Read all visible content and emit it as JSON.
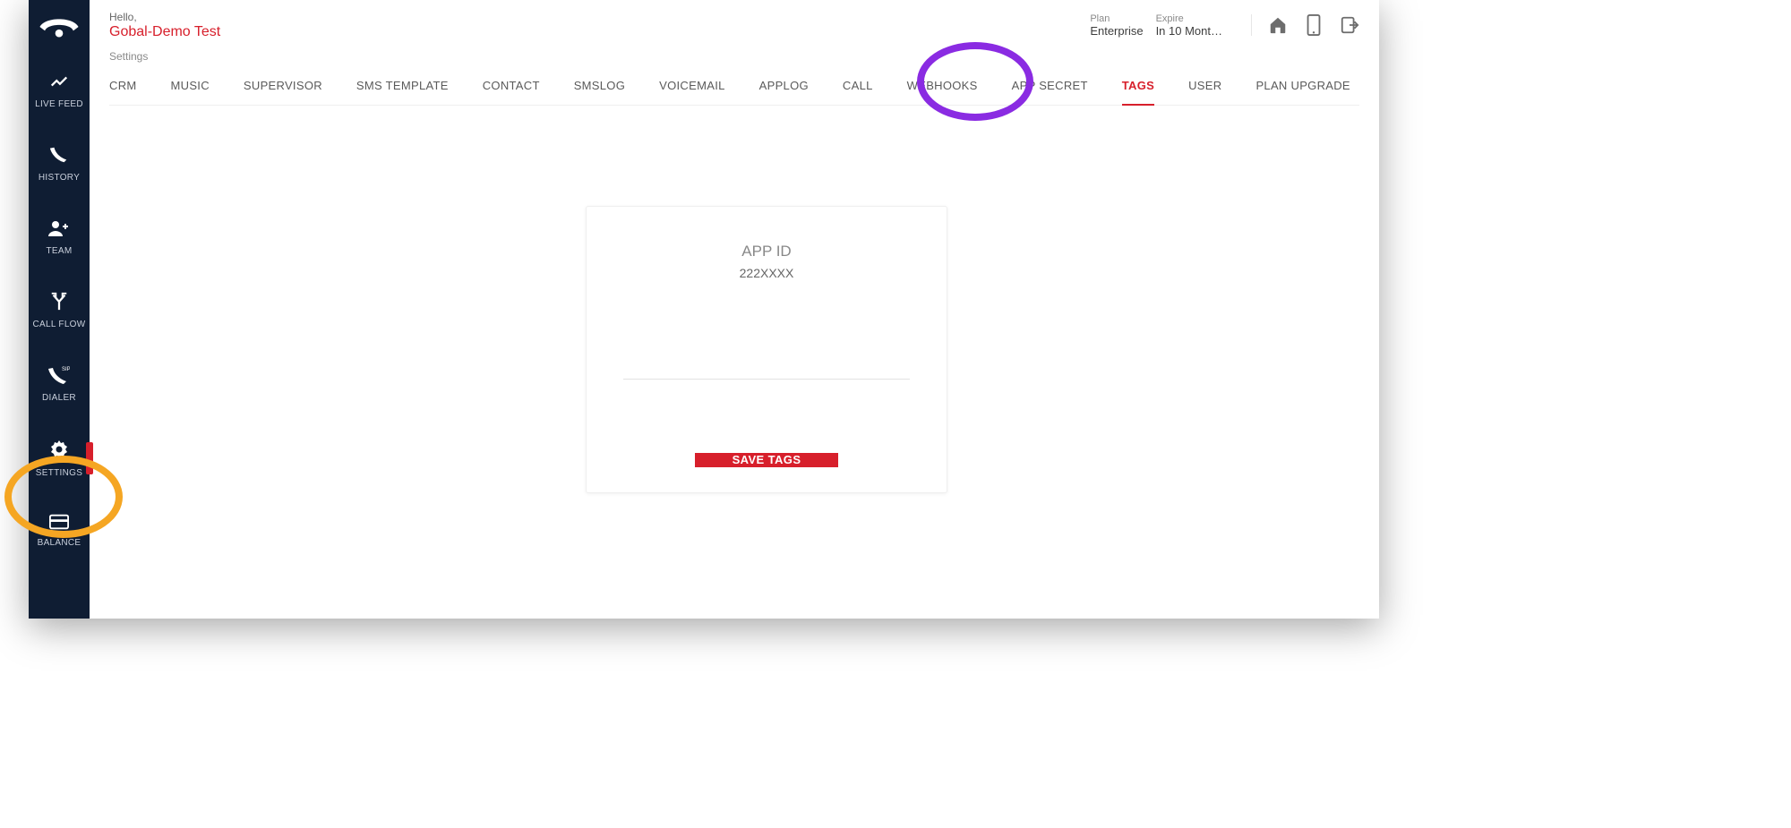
{
  "header": {
    "hello": "Hello,",
    "user": "Gobal-Demo Test",
    "plan_label": "Plan",
    "plan_value": "Enterprise",
    "expire_label": "Expire",
    "expire_value": "In 10 Mont…"
  },
  "sidebar": {
    "items": [
      {
        "label": "LIVE FEED",
        "name": "live-feed"
      },
      {
        "label": "HISTORY",
        "name": "history"
      },
      {
        "label": "TEAM",
        "name": "team"
      },
      {
        "label": "CALL FLOW",
        "name": "call-flow"
      },
      {
        "label": "DIALER",
        "name": "dialer"
      },
      {
        "label": "SETTINGS",
        "name": "settings",
        "active": true
      },
      {
        "label": "BALANCE",
        "name": "balance"
      }
    ]
  },
  "tabs": {
    "heading": "Settings",
    "items": [
      {
        "label": "CRM"
      },
      {
        "label": "MUSIC"
      },
      {
        "label": "SUPERVISOR"
      },
      {
        "label": "SMS TEMPLATE"
      },
      {
        "label": "CONTACT"
      },
      {
        "label": "SMSLOG"
      },
      {
        "label": "VOICEMAIL"
      },
      {
        "label": "APPLOG"
      },
      {
        "label": "CALL"
      },
      {
        "label": "WEBHOOKS"
      },
      {
        "label": "APP SECRET"
      },
      {
        "label": "TAGS",
        "active": true
      },
      {
        "label": "USER"
      },
      {
        "label": "PLAN UPGRADE"
      }
    ]
  },
  "card": {
    "title": "APP ID",
    "appid": "222XXXX",
    "save_label": "SAVE TAGS"
  },
  "icons": {
    "home": "home-icon",
    "phone": "phone-icon",
    "exit": "exit-icon"
  }
}
